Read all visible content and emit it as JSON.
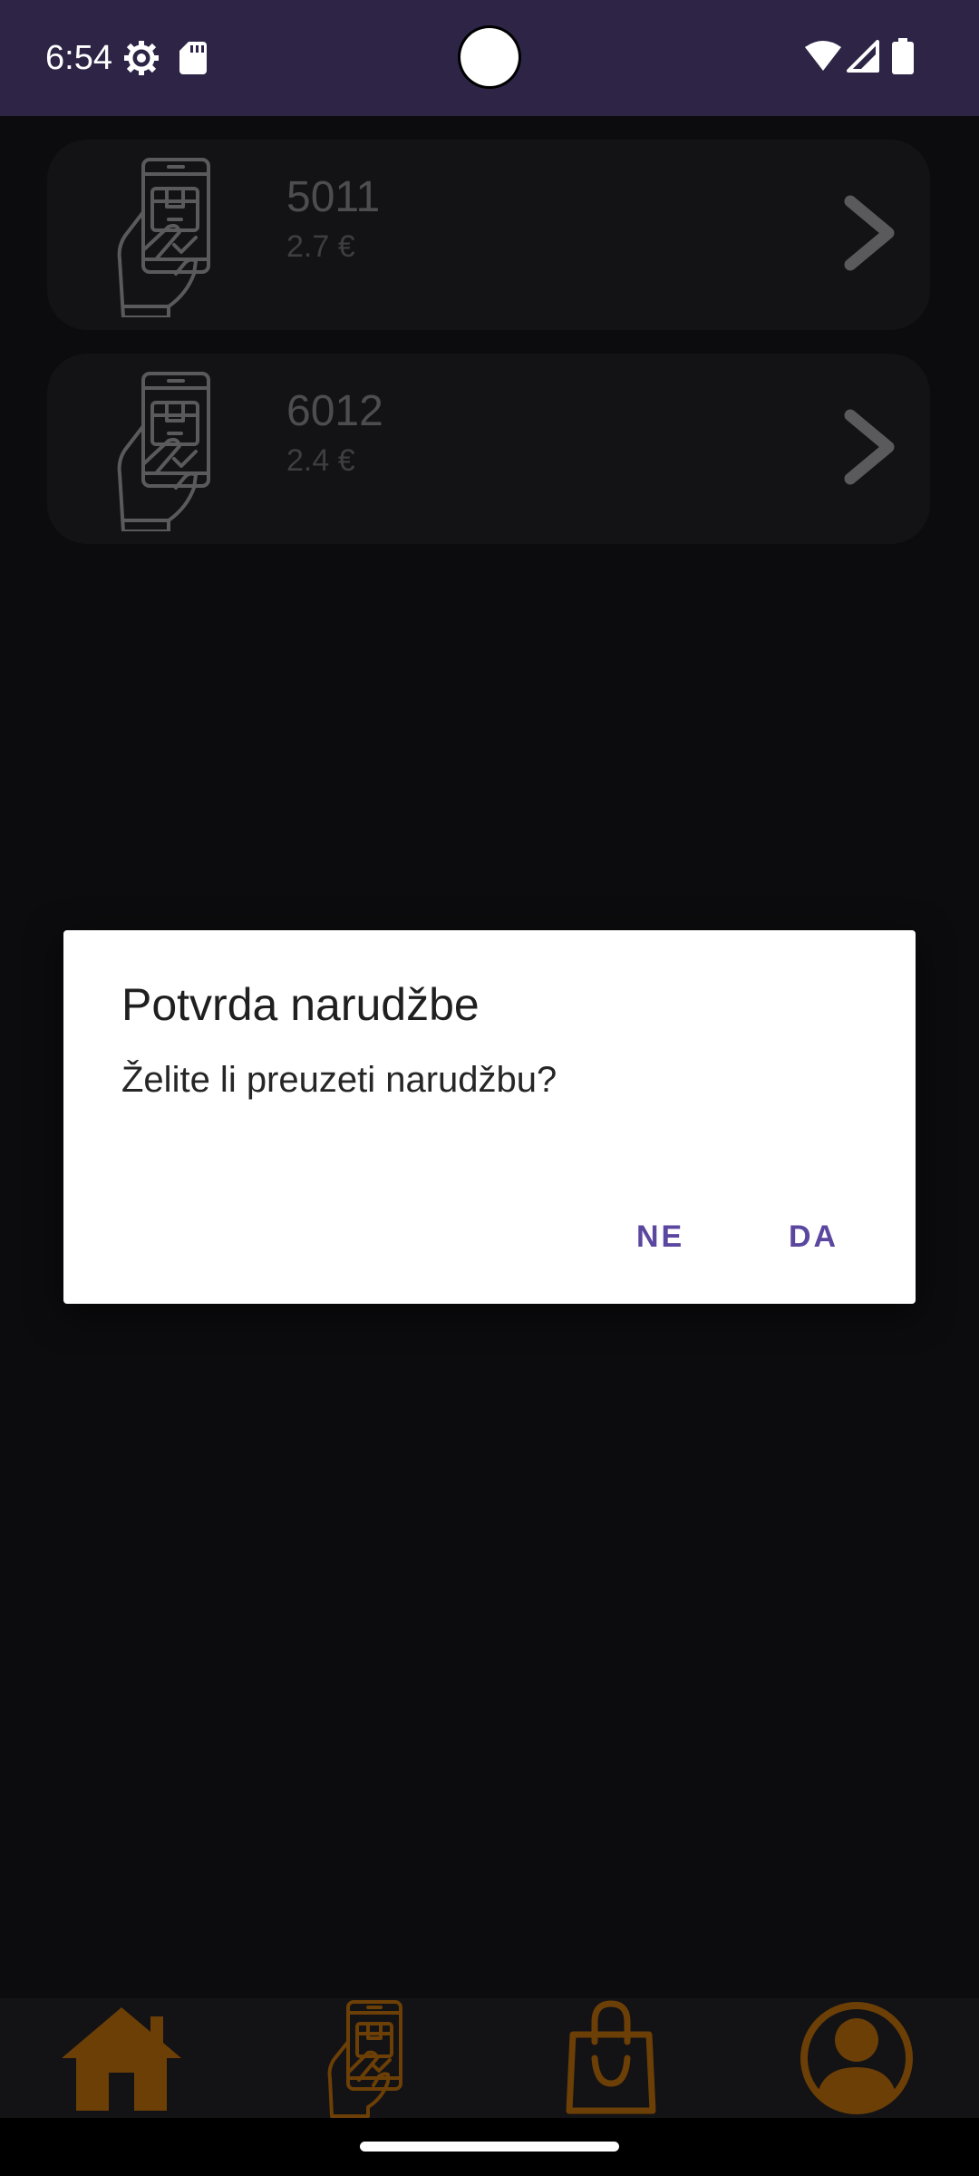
{
  "status_bar": {
    "time": "6:54",
    "icons": [
      "gear-icon",
      "sd-card-icon",
      "wifi-icon",
      "signal-icon",
      "battery-icon"
    ]
  },
  "orders": [
    {
      "number": "5011",
      "price": "2.7 €",
      "icon": "phone-package-hand-icon"
    },
    {
      "number": "6012",
      "price": "2.4 €",
      "icon": "phone-package-hand-icon"
    }
  ],
  "dialog": {
    "title": "Potvrda narudžbe",
    "message": "Želite li preuzeti narudžbu?",
    "negative_label": "NE",
    "positive_label": "DA"
  },
  "bottom_nav": {
    "items": [
      "home-icon",
      "orders-icon",
      "shopping-bag-icon",
      "profile-icon"
    ]
  },
  "colors": {
    "status_bar": "#2d2446",
    "accent_dialog_button": "#5b47a0",
    "nav_icon": "#6b3f06",
    "background": "#0c0c0e"
  }
}
